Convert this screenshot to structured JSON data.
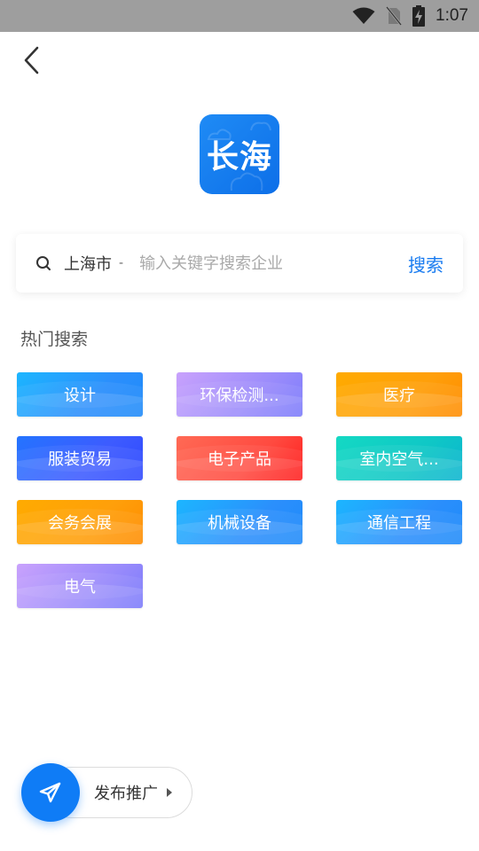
{
  "status_bar": {
    "time": "1:07",
    "icons": [
      "wifi-icon",
      "no-sim-icon",
      "battery-charging-icon"
    ]
  },
  "header": {
    "back_icon": "chevron-left-icon"
  },
  "logo": {
    "text": "长海",
    "color": "#1a80f2"
  },
  "search": {
    "icon": "search-icon",
    "city": "上海市",
    "city_caret": "-",
    "placeholder": "输入关键字搜索企业",
    "value": "",
    "button_label": "搜索",
    "accent_color": "#1a7cf0"
  },
  "hot_search": {
    "title": "热门搜索",
    "tags": [
      {
        "label": "设计",
        "theme": "blue"
      },
      {
        "label": "环保检测...",
        "theme": "purple"
      },
      {
        "label": "医疗",
        "theme": "orange"
      },
      {
        "label": "服装贸易",
        "theme": "indigo"
      },
      {
        "label": "电子产品",
        "theme": "red"
      },
      {
        "label": "室内空气...",
        "theme": "teal"
      },
      {
        "label": "会务会展",
        "theme": "orange"
      },
      {
        "label": "机械设备",
        "theme": "blue"
      },
      {
        "label": "通信工程",
        "theme": "blue"
      },
      {
        "label": "电气",
        "theme": "purple"
      }
    ]
  },
  "promo": {
    "icon": "paper-plane-icon",
    "label": "发布推广",
    "caret_icon": "caret-right-icon",
    "fab_color": "#0f7cf6"
  }
}
